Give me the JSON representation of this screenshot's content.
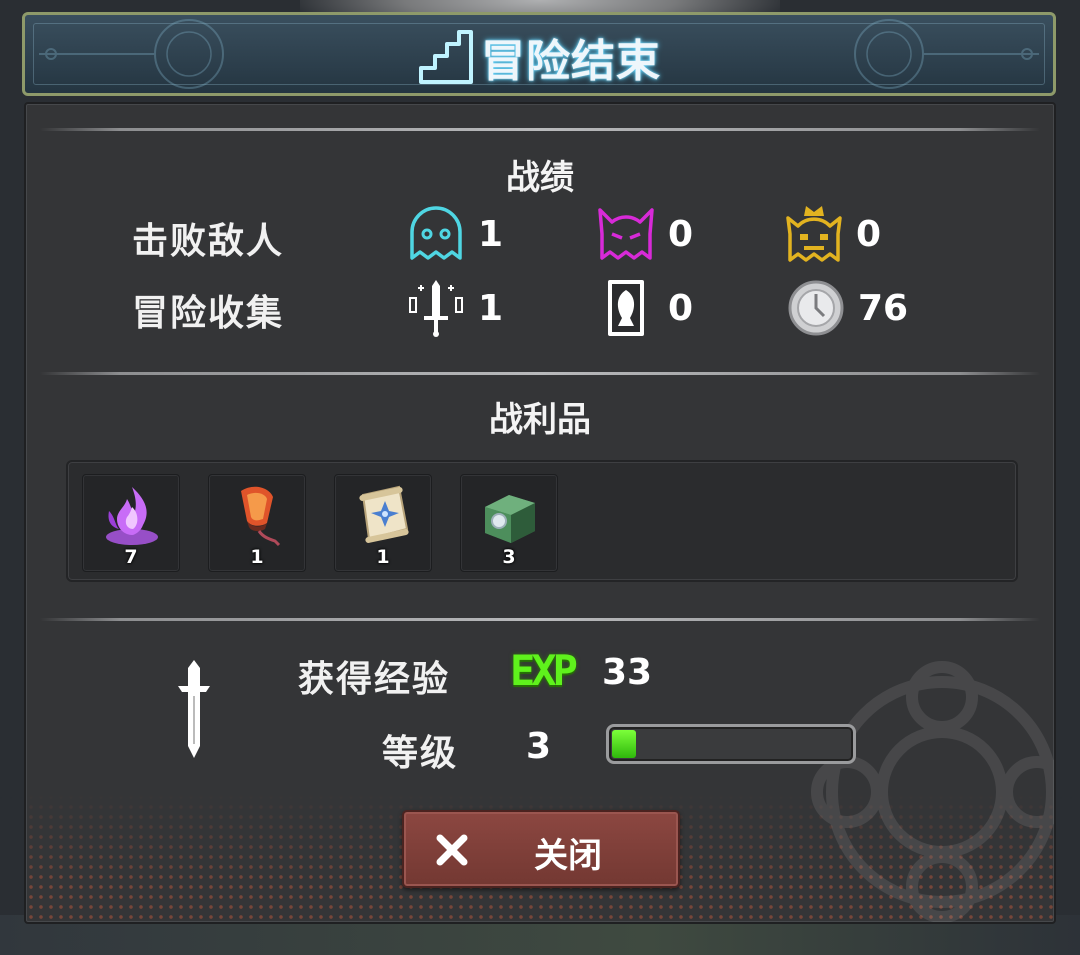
{
  "header": {
    "title": "冒险结束"
  },
  "stats": {
    "title": "战绩",
    "defeated": {
      "label": "击败敌人",
      "normal": {
        "icon": "ghost-icon",
        "count": "1",
        "color": "#4fd6e3"
      },
      "elite": {
        "icon": "horned-ghost-icon",
        "count": "0",
        "color": "#d82ad8"
      },
      "boss": {
        "icon": "crowned-ghost-icon",
        "count": "0",
        "color": "#e2b320"
      }
    },
    "collected": {
      "label": "冒险收集",
      "equipment": {
        "icon": "sword-icon",
        "count": "1"
      },
      "cards": {
        "icon": "card-icon",
        "count": "0"
      },
      "coins": {
        "icon": "coin-icon",
        "count": "76"
      }
    }
  },
  "loot": {
    "title": "战利品",
    "items": [
      {
        "icon": "purple-flame-icon",
        "qty": "7"
      },
      {
        "icon": "lantern-icon",
        "qty": "1"
      },
      {
        "icon": "scroll-icon",
        "qty": "1"
      },
      {
        "icon": "treasure-chest-icon",
        "qty": "3"
      }
    ]
  },
  "experience": {
    "label": "获得经验",
    "badge": "EXP",
    "value": "33",
    "level_label": "等级",
    "level": "3",
    "progress": 0.1
  },
  "close_button": {
    "label": "关闭"
  },
  "colors": {
    "exp_green": "#5ff21c",
    "button_red": "#7f4039"
  }
}
